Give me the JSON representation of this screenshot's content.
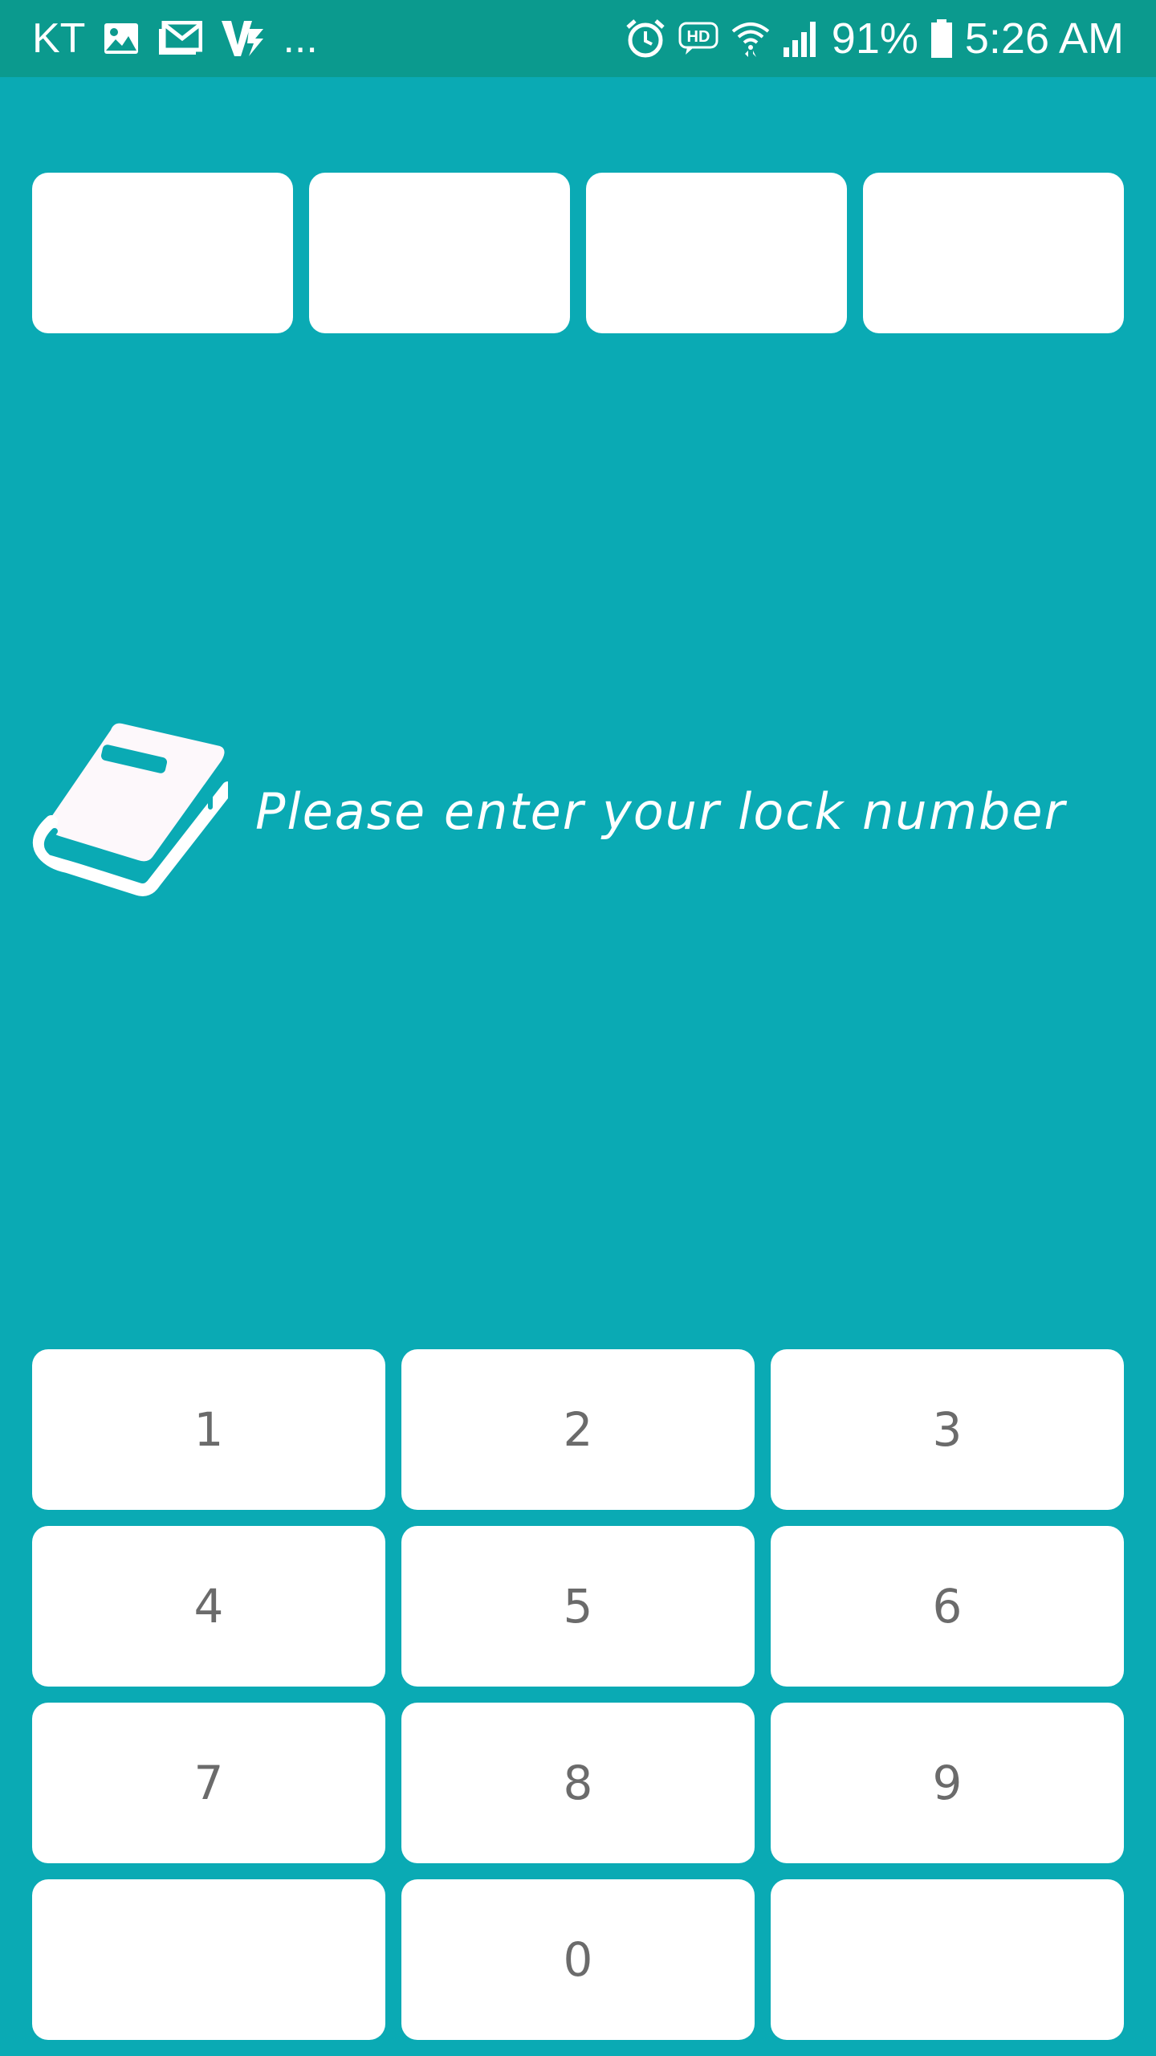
{
  "status_bar": {
    "carrier": "KT",
    "overflow": "...",
    "battery_percent": "91%",
    "time": "5:26 AM",
    "icons_left": [
      "image-icon",
      "gmail-icon",
      "v3-icon"
    ],
    "icons_right": [
      "alarm-icon",
      "hd-icon",
      "wifi-icon",
      "signal-icon",
      "battery-icon"
    ]
  },
  "pin": {
    "slots": 4
  },
  "prompt": {
    "text": "Please enter your lock number",
    "icon": "book-icon"
  },
  "keypad": {
    "keys": [
      "1",
      "2",
      "3",
      "4",
      "5",
      "6",
      "7",
      "8",
      "9",
      "",
      "0",
      ""
    ]
  },
  "colors": {
    "background": "#0aaab4",
    "status_bar": "#0b9a8e",
    "key_bg": "#ffffff",
    "key_text": "#6b6b6b"
  }
}
